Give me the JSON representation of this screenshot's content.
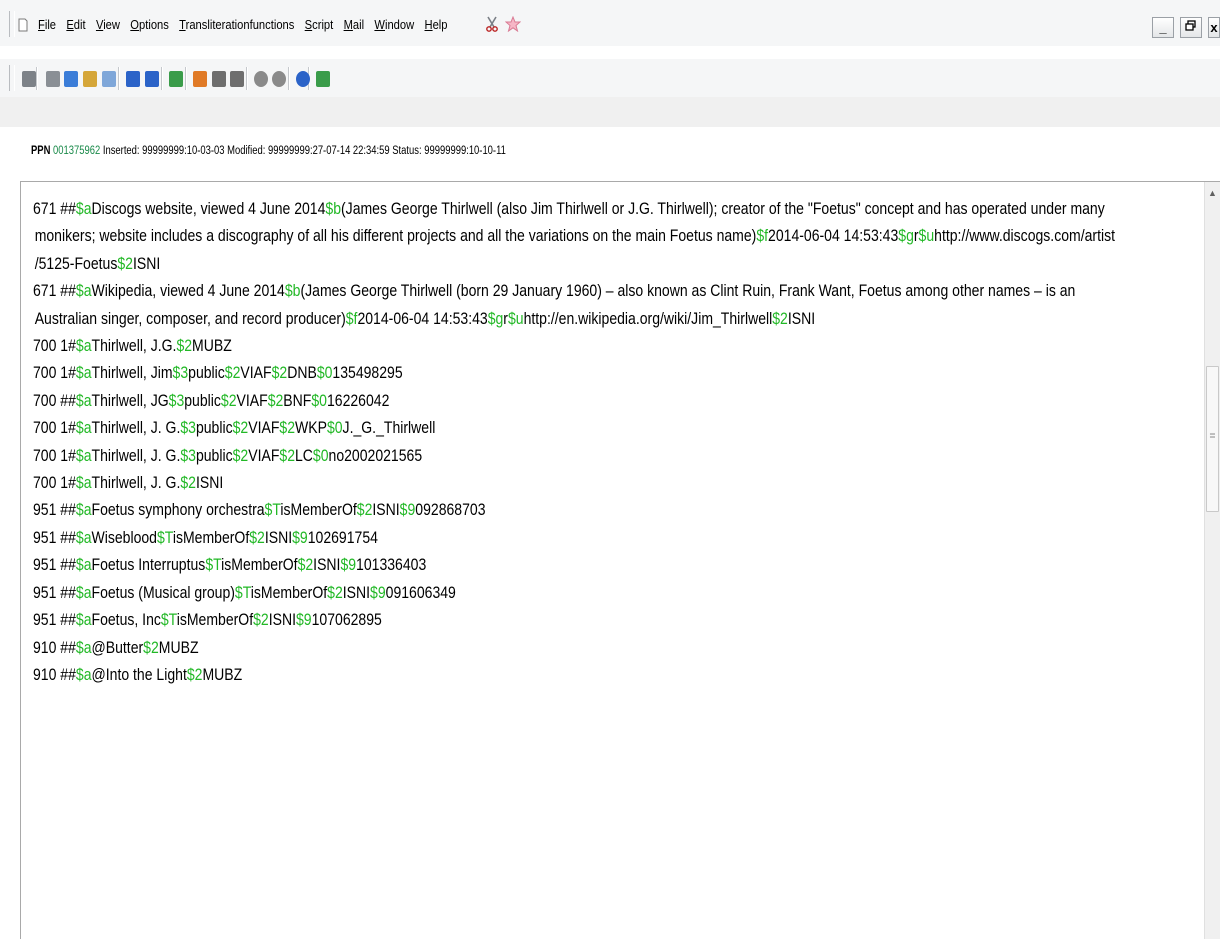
{
  "menubar": {
    "items": [
      {
        "label": "File"
      },
      {
        "label": "Edit"
      },
      {
        "label": "View"
      },
      {
        "label": "Options"
      },
      {
        "label": "Transliterationfunctions"
      },
      {
        "label": "Script"
      },
      {
        "label": "Mail"
      },
      {
        "label": "Window"
      },
      {
        "label": "Help"
      }
    ],
    "extras": [
      {
        "icon": "scissors-icon"
      },
      {
        "icon": "pink-star-icon"
      }
    ],
    "window_controls": [
      {
        "label": "_"
      },
      {
        "label": "ȅ"
      },
      {
        "label": "x"
      }
    ]
  },
  "toolbar": {
    "icons": [
      "print-icon",
      "cut-icon",
      "copy-icon",
      "paste-icon",
      "document-icon",
      "undo-icon",
      "redo-icon",
      "refresh-icon",
      "fire-icon",
      "record-a-icon",
      "record-b-icon",
      "back-icon",
      "forward-icon",
      "globe-icon",
      "font-dropdown-icon"
    ]
  },
  "status": {
    "ppn_label": "PPN",
    "ppn_value": "001375962",
    "meta": "Inserted: 99999999:10-03-03 Modified: 99999999:27-07-14 22:34:59 Status: 99999999:10-10-11"
  },
  "records": [
    {
      "lines": [
        [
          [
            "671 ##",
            0
          ],
          [
            "$a",
            1
          ],
          [
            "Discogs website, viewed 4 June 2014",
            0
          ],
          [
            "$b",
            1
          ],
          [
            "(James George Thirlwell (also Jim Thirlwell or J.G. Thirlwell); creator of the \"Foetus\" concept and has operated under many",
            0
          ]
        ],
        [
          [
            "monikers; website includes a discography of all his different projects and all the variations on the main Foetus name)",
            0
          ],
          [
            "$f",
            1
          ],
          [
            "2014-06-04 14:53:43",
            0
          ],
          [
            "$g",
            1
          ],
          [
            "r",
            0
          ],
          [
            "$u",
            1
          ],
          [
            "http://www.discogs.com/artist",
            0
          ]
        ],
        [
          [
            "/5125-Foetus",
            0
          ],
          [
            "$2",
            1
          ],
          [
            "ISNI",
            0
          ]
        ]
      ]
    },
    {
      "lines": [
        [
          [
            "671 ##",
            0
          ],
          [
            "$a",
            1
          ],
          [
            "Wikipedia, viewed 4 June 2014",
            0
          ],
          [
            "$b",
            1
          ],
          [
            "(James George Thirlwell (born 29 January 1960) – also known as Clint Ruin, Frank Want, Foetus among other names – is an",
            0
          ]
        ],
        [
          [
            "Australian singer, composer, and record producer)",
            0
          ],
          [
            "$f",
            1
          ],
          [
            "2014-06-04 14:53:43",
            0
          ],
          [
            "$g",
            1
          ],
          [
            "r",
            0
          ],
          [
            "$u",
            1
          ],
          [
            "http://en.wikipedia.org/wiki/Jim_Thirlwell",
            0
          ],
          [
            "$2",
            1
          ],
          [
            "ISNI",
            0
          ]
        ]
      ]
    },
    {
      "lines": [
        [
          [
            "700 1#",
            0
          ],
          [
            "$a",
            1
          ],
          [
            "Thirlwell, J.G.",
            0
          ],
          [
            "$2",
            1
          ],
          [
            "MUBZ",
            0
          ]
        ]
      ]
    },
    {
      "lines": [
        [
          [
            "700 1#",
            0
          ],
          [
            "$a",
            1
          ],
          [
            "Thirlwell, Jim",
            0
          ],
          [
            "$3",
            1
          ],
          [
            "public",
            0
          ],
          [
            "$2",
            1
          ],
          [
            "VIAF",
            0
          ],
          [
            "$2",
            1
          ],
          [
            "DNB",
            0
          ],
          [
            "$0",
            1
          ],
          [
            "135498295",
            0
          ]
        ]
      ]
    },
    {
      "lines": [
        [
          [
            "700 ##",
            0
          ],
          [
            "$a",
            1
          ],
          [
            "Thirlwell, JG",
            0
          ],
          [
            "$3",
            1
          ],
          [
            "public",
            0
          ],
          [
            "$2",
            1
          ],
          [
            "VIAF",
            0
          ],
          [
            "$2",
            1
          ],
          [
            "BNF",
            0
          ],
          [
            "$0",
            1
          ],
          [
            "16226042",
            0
          ]
        ]
      ]
    },
    {
      "lines": [
        [
          [
            "700 1#",
            0
          ],
          [
            "$a",
            1
          ],
          [
            "Thirlwell, J. G.",
            0
          ],
          [
            "$3",
            1
          ],
          [
            "public",
            0
          ],
          [
            "$2",
            1
          ],
          [
            "VIAF",
            0
          ],
          [
            "$2",
            1
          ],
          [
            "WKP",
            0
          ],
          [
            "$0",
            1
          ],
          [
            "J._G._Thirlwell",
            0
          ]
        ]
      ]
    },
    {
      "lines": [
        [
          [
            "700 1#",
            0
          ],
          [
            "$a",
            1
          ],
          [
            "Thirlwell, J. G.",
            0
          ],
          [
            "$3",
            1
          ],
          [
            "public",
            0
          ],
          [
            "$2",
            1
          ],
          [
            "VIAF",
            0
          ],
          [
            "$2",
            1
          ],
          [
            "LC",
            0
          ],
          [
            "$0",
            1
          ],
          [
            "no2002021565",
            0
          ]
        ]
      ]
    },
    {
      "lines": [
        [
          [
            "700 1#",
            0
          ],
          [
            "$a",
            1
          ],
          [
            "Thirlwell, J. G.",
            0
          ],
          [
            "$2",
            1
          ],
          [
            "ISNI",
            0
          ]
        ]
      ]
    },
    {
      "lines": [
        [
          [
            "951 ##",
            0
          ],
          [
            "$a",
            1
          ],
          [
            "Foetus symphony orchestra",
            0
          ],
          [
            "$T",
            1
          ],
          [
            "isMemberOf",
            0
          ],
          [
            "$2",
            1
          ],
          [
            "ISNI",
            0
          ],
          [
            "$9",
            1
          ],
          [
            "092868703",
            0
          ]
        ]
      ]
    },
    {
      "lines": [
        [
          [
            "951 ##",
            0
          ],
          [
            "$a",
            1
          ],
          [
            "Wiseblood",
            0
          ],
          [
            "$T",
            1
          ],
          [
            "isMemberOf",
            0
          ],
          [
            "$2",
            1
          ],
          [
            "ISNI",
            0
          ],
          [
            "$9",
            1
          ],
          [
            "102691754",
            0
          ]
        ]
      ]
    },
    {
      "lines": [
        [
          [
            "951 ##",
            0
          ],
          [
            "$a",
            1
          ],
          [
            "Foetus Interruptus",
            0
          ],
          [
            "$T",
            1
          ],
          [
            "isMemberOf",
            0
          ],
          [
            "$2",
            1
          ],
          [
            "ISNI",
            0
          ],
          [
            "$9",
            1
          ],
          [
            "101336403",
            0
          ]
        ]
      ]
    },
    {
      "lines": [
        [
          [
            "951 ##",
            0
          ],
          [
            "$a",
            1
          ],
          [
            "Foetus (Musical group)",
            0
          ],
          [
            "$T",
            1
          ],
          [
            "isMemberOf",
            0
          ],
          [
            "$2",
            1
          ],
          [
            "ISNI",
            0
          ],
          [
            "$9",
            1
          ],
          [
            "091606349",
            0
          ]
        ]
      ]
    },
    {
      "lines": [
        [
          [
            "951 ##",
            0
          ],
          [
            "$a",
            1
          ],
          [
            "Foetus, Inc",
            0
          ],
          [
            "$T",
            1
          ],
          [
            "isMemberOf",
            0
          ],
          [
            "$2",
            1
          ],
          [
            "ISNI",
            0
          ],
          [
            "$9",
            1
          ],
          [
            "107062895",
            0
          ]
        ]
      ]
    },
    {
      "lines": [
        [
          [
            "910 ##",
            0
          ],
          [
            "$a",
            1
          ],
          [
            "@Butter",
            0
          ],
          [
            "$2",
            1
          ],
          [
            "MUBZ",
            0
          ]
        ]
      ]
    },
    {
      "lines": [
        [
          [
            "910 ##",
            0
          ],
          [
            "$a",
            1
          ],
          [
            "@Into the Light",
            0
          ],
          [
            "$2",
            1
          ],
          [
            "MUBZ",
            0
          ]
        ]
      ]
    }
  ],
  "colors": {
    "subfield": "#22b826",
    "ppn": "#1a8a4a"
  }
}
